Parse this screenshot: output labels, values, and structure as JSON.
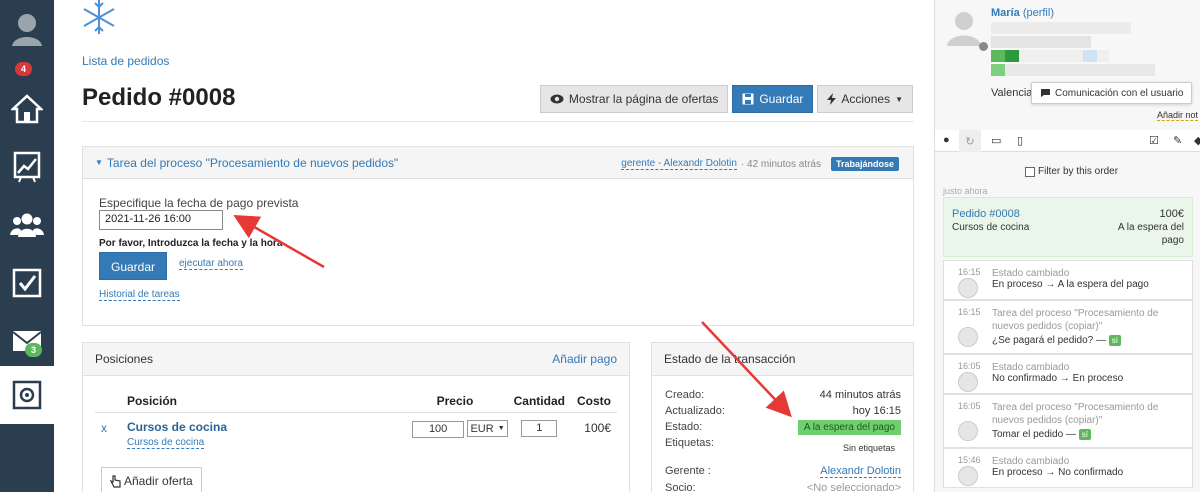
{
  "nav": {
    "badge_orders": "4",
    "badge_mail": "3",
    "icons": [
      "user-avatar-icon",
      "home-icon",
      "chart-icon",
      "users-icon",
      "tasks-icon",
      "mail-icon",
      "settings-icon"
    ]
  },
  "breadcrumb": "Lista de pedidos",
  "page_title": "Pedido #0008",
  "toolbar": {
    "show_offers": "Mostrar la página de ofertas",
    "save": "Guardar",
    "actions": "Acciones"
  },
  "task": {
    "title": "Tarea del proceso \"Procesamiento de nuevos pedidos\"",
    "manager": "gerente - Alexandr Dolotin",
    "time": "· 42 minutos atrás",
    "status": "Trabajándose",
    "field_label": "Especifique la fecha de pago prevista",
    "date_value": "2021-11-26 16:00",
    "hint": "Por favor, Introduzca la fecha y la hora",
    "save": "Guardar",
    "execute_now": "ejecutar ahora",
    "history": "Historial de tareas"
  },
  "positions": {
    "title": "Posiciones",
    "add_payment": "Añadir pago",
    "columns": [
      "Posición",
      "Precio",
      "Cantidad",
      "Costo"
    ],
    "rows": [
      {
        "remove": "x",
        "name": "Cursos de cocina",
        "sub": "Cursos de cocina",
        "price": "100",
        "currency": "EUR",
        "qty": "1",
        "cost": "100€"
      }
    ],
    "add_offer": "Añadir oferta"
  },
  "transaction": {
    "title": "Estado de la transacción",
    "created_label": "Creado:",
    "created": "44 minutos atrás",
    "updated_label": "Actualizado:",
    "updated": "hoy 16:15",
    "state_label": "Estado:",
    "state": "A la espera del pago",
    "tags_label": "Etiquetas:",
    "tags": "Sin etiquetas",
    "manager_label": "Gerente :",
    "manager": "Alexandr Dolotin",
    "partner_label": "Socio:",
    "partner": "<No seleccionado>"
  },
  "sidebar": {
    "user_name": "María",
    "profile_link": "(perfil)",
    "city": "Valencia",
    "comm_button": "Comunicación con el usuario",
    "add_note": "Añadir not",
    "filter_label": "Filter by this order",
    "just_now": "justo ahora",
    "order_card": {
      "title": "Pedido #0008",
      "amount": "100€",
      "product": "Cursos de cocina",
      "status_1": "A la espera del",
      "status_2": "pago"
    },
    "history": [
      {
        "time": "16:15",
        "title": "Estado cambiado",
        "text": "En proceso → A la espera del pago"
      },
      {
        "time": "16:15",
        "title": "Tarea del proceso \"Procesamiento de nuevos pedidos (copiar)\"",
        "text": "¿Se pagará el pedido? —",
        "chip": "sí"
      },
      {
        "time": "16:05",
        "title": "Estado cambiado",
        "text": "No confirmado → En proceso"
      },
      {
        "time": "16:05",
        "title": "Tarea del proceso \"Procesamiento de nuevos pedidos (copiar)\"",
        "text": "Tomar el pedido —",
        "chip": "sí"
      },
      {
        "time": "15:46",
        "title": "Estado cambiado",
        "text": "En proceso → No confirmado"
      }
    ]
  }
}
